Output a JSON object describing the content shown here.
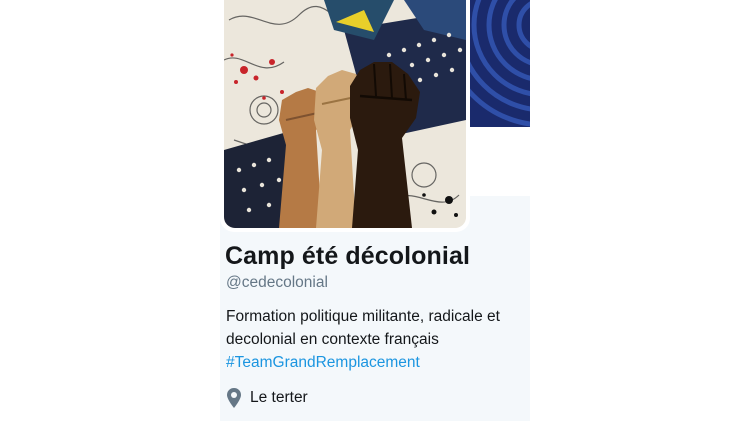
{
  "profile": {
    "display_name": "Camp été décolonial",
    "handle": "@cedecolonial",
    "bio": {
      "line1": "Formation politique militante, radicale et",
      "line2": "decolonial en contexte français",
      "hashtag": "#TeamGrandRemplacement"
    },
    "location": "Le terter",
    "avatar_icon": "raised-fists-artwork",
    "location_icon": "map-pin-icon"
  },
  "colors": {
    "name_text": "#14171a",
    "secondary_text": "#657786",
    "link": "#1b95e0",
    "card_background": "#f4f8fb",
    "banner_background": "#1a2a6c"
  }
}
